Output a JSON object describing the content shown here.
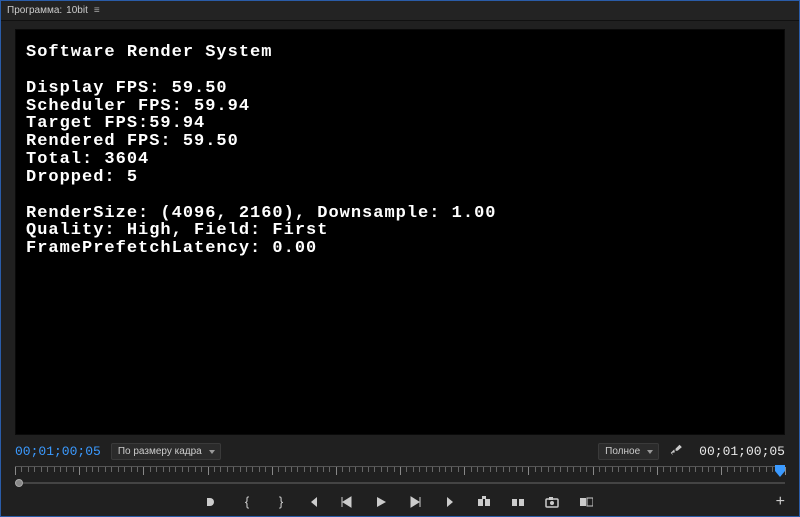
{
  "titlebar": {
    "label": "Программа:",
    "name": "10bit"
  },
  "debug": {
    "title": "Software Render System",
    "lines": {
      "display_fps": "Display FPS: 59.50",
      "scheduler_fps": "Scheduler FPS: 59.94",
      "target_fps": "Target FPS:59.94",
      "rendered_fps": "Rendered FPS: 59.50",
      "total": "Total: 3604",
      "dropped": "Dropped: 5",
      "render_size": "RenderSize: (4096, 2160), Downsample: 1.00",
      "quality": "Quality: High, Field: First",
      "prefetch": "FramePrefetchLatency: 0.00"
    }
  },
  "controls": {
    "timecode_current": "00;01;00;05",
    "timecode_total": "00;01;00;05",
    "zoom_dropdown": "По размеру кадра",
    "quality_dropdown": "Полное"
  }
}
